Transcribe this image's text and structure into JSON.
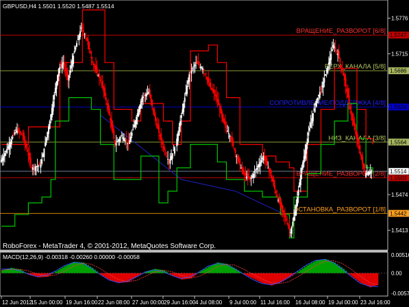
{
  "header": {
    "symbol_info": "GBPUSD,H4  1.5501  1.5520  1.5487  1.5514",
    "macd_info": "MACD(12,26,9)  -0.00318  -0.00260  0.00000  -0.00058"
  },
  "watermark": "RoboForex - MetaTrader 4, © 2001-2012, MetaQuotes Software Corp.",
  "price_axis": {
    "ticks": [
      "1.5776",
      "1.5715",
      "1.5625",
      "1.5564",
      "1.5474",
      "1.5413"
    ],
    "ylim": [
      1.5385,
      1.58
    ]
  },
  "macd_axis": {
    "ticks": [
      "0.00516",
      "0.00",
      "-0.00571"
    ]
  },
  "time_axis": {
    "ticks": [
      "12 Jun 2012",
      "15 Jun 00:00",
      "19 Jun 16:00",
      "22 Jun 08:00",
      "27 Jun 00:00",
      "29 Jun 16:00",
      "4 Jul 08:00",
      "9 Jul 00:00",
      "11 Jul 16:00",
      "16 Jul 08:00",
      "19 Jul 00:00",
      "23 Jul 16:00"
    ]
  },
  "levels": [
    {
      "label": "ВРАЩЕНИЕ_РАЗВОРОТ [6/8]",
      "price_tag": "1.5747",
      "value": 1.5747,
      "color": "#c00000",
      "text_color": "#ff3030",
      "tag_bg": "#c00000"
    },
    {
      "label": "ВЕРХ_КАНАЛА [5/8]",
      "price_tag": "1.5686",
      "value": 1.5686,
      "color": "#8a9a3a",
      "text_color": "#b8c860",
      "tag_bg": "#a8b860"
    },
    {
      "label": "СОПРОТИВЛЕНИЕ/ПОДДЕРЖКА [4/8]",
      "price_tag": "1.5624",
      "value": 1.5624,
      "color": "#0000c8",
      "text_color": "#2020ff",
      "tag_bg": "#0000c8"
    },
    {
      "label": "НИЗ_КАНАЛА [3/8]",
      "price_tag": "1.5564",
      "value": 1.5564,
      "color": "#8a9a3a",
      "text_color": "#b8c860",
      "tag_bg": "#a8b860"
    },
    {
      "label": "ВРАЩЕНИЕ_РАЗВОРОТ [2/8]",
      "price_tag": "1.5503",
      "value": 1.5503,
      "color": "#c00000",
      "text_color": "#ff3030",
      "tag_bg": "#c00000"
    },
    {
      "label": "ОСТАНОВКА_РАЗВОРОТ [1/8]",
      "price_tag": "1.5442",
      "value": 1.5442,
      "color": "#d08000",
      "text_color": "#ffa020",
      "tag_bg": "#ffa020"
    }
  ],
  "current_price": {
    "tag": "1.5514",
    "value": 1.5514
  },
  "colors": {
    "bull_candle": "#ffffff",
    "bear_candle": "#ff0000",
    "upper_channel": "#ff0000",
    "lower_channel": "#00c800",
    "diagonal_line": "#2020c0",
    "macd_pos": "#00a000",
    "macd_neg": "#e00000",
    "macd_line1": "#3050ff",
    "macd_line2": "#ff4040"
  },
  "chart_data": {
    "type": "candlestick",
    "symbol": "GBPUSD",
    "timeframe": "H4",
    "close_path": [
      [
        0,
        1.553
      ],
      [
        4,
        1.556
      ],
      [
        7,
        1.5585
      ],
      [
        10,
        1.5575
      ],
      [
        14,
        1.552
      ],
      [
        18,
        1.5525
      ],
      [
        22,
        1.56
      ],
      [
        26,
        1.569
      ],
      [
        28,
        1.57
      ],
      [
        30,
        1.567
      ],
      [
        33,
        1.572
      ],
      [
        36,
        1.576
      ],
      [
        38,
        1.5745
      ],
      [
        41,
        1.57
      ],
      [
        45,
        1.5665
      ],
      [
        48,
        1.562
      ],
      [
        51,
        1.556
      ],
      [
        54,
        1.5575
      ],
      [
        57,
        1.556
      ],
      [
        60,
        1.56
      ],
      [
        63,
        1.564
      ],
      [
        66,
        1.565
      ],
      [
        69,
        1.56
      ],
      [
        72,
        1.556
      ],
      [
        75,
        1.553
      ],
      [
        78,
        1.556
      ],
      [
        81,
        1.562
      ],
      [
        84,
        1.568
      ],
      [
        87,
        1.57
      ],
      [
        90,
        1.569
      ],
      [
        93,
        1.566
      ],
      [
        96,
        1.564
      ],
      [
        99,
        1.56
      ],
      [
        102,
        1.5575
      ],
      [
        105,
        1.554
      ],
      [
        108,
        1.551
      ],
      [
        111,
        1.55
      ],
      [
        114,
        1.552
      ],
      [
        117,
        1.554
      ],
      [
        120,
        1.551
      ],
      [
        123,
        1.547
      ],
      [
        126,
        1.544
      ],
      [
        129,
        1.541
      ],
      [
        131,
        1.5445
      ],
      [
        134,
        1.552
      ],
      [
        137,
        1.558
      ],
      [
        140,
        1.563
      ],
      [
        143,
        1.566
      ],
      [
        146,
        1.57
      ],
      [
        148,
        1.573
      ],
      [
        150,
        1.5715
      ],
      [
        153,
        1.567
      ],
      [
        156,
        1.561
      ],
      [
        159,
        1.556
      ],
      [
        162,
        1.551
      ],
      [
        165,
        1.5515
      ]
    ],
    "upper_channel": [
      [
        0,
        1.556
      ],
      [
        10,
        1.556
      ],
      [
        12,
        1.559
      ],
      [
        24,
        1.559
      ],
      [
        26,
        1.57
      ],
      [
        34,
        1.57
      ],
      [
        36,
        1.579
      ],
      [
        44,
        1.579
      ],
      [
        46,
        1.57
      ],
      [
        50,
        1.562
      ],
      [
        58,
        1.56
      ],
      [
        62,
        1.563
      ],
      [
        72,
        1.56
      ],
      [
        76,
        1.556
      ],
      [
        80,
        1.56
      ],
      [
        84,
        1.572
      ],
      [
        92,
        1.573
      ],
      [
        96,
        1.57
      ],
      [
        100,
        1.564
      ],
      [
        106,
        1.556
      ],
      [
        116,
        1.554
      ],
      [
        122,
        1.553
      ],
      [
        128,
        1.552
      ],
      [
        130,
        1.548
      ],
      [
        136,
        1.556
      ],
      [
        142,
        1.562
      ],
      [
        148,
        1.569
      ],
      [
        154,
        1.569
      ],
      [
        158,
        1.562
      ],
      [
        162,
        1.557
      ],
      [
        165,
        1.556
      ]
    ],
    "lower_channel": [
      [
        0,
        1.542
      ],
      [
        6,
        1.544
      ],
      [
        12,
        1.546
      ],
      [
        18,
        1.547
      ],
      [
        22,
        1.55
      ],
      [
        24,
        1.56
      ],
      [
        30,
        1.564
      ],
      [
        36,
        1.564
      ],
      [
        40,
        1.562
      ],
      [
        44,
        1.556
      ],
      [
        50,
        1.55
      ],
      [
        58,
        1.55
      ],
      [
        62,
        1.554
      ],
      [
        68,
        1.554
      ],
      [
        70,
        1.546
      ],
      [
        74,
        1.548
      ],
      [
        78,
        1.552
      ],
      [
        84,
        1.556
      ],
      [
        92,
        1.556
      ],
      [
        96,
        1.553
      ],
      [
        100,
        1.55
      ],
      [
        108,
        1.548
      ],
      [
        116,
        1.547
      ],
      [
        124,
        1.544
      ],
      [
        128,
        1.54
      ],
      [
        130,
        1.547
      ],
      [
        136,
        1.551
      ],
      [
        142,
        1.556
      ],
      [
        148,
        1.56
      ],
      [
        154,
        1.563
      ],
      [
        158,
        1.557
      ],
      [
        162,
        1.552
      ],
      [
        165,
        1.551
      ]
    ],
    "diagonal_line": [
      [
        44,
        1.561
      ],
      [
        80,
        1.55
      ],
      [
        104,
        1.548
      ],
      [
        126,
        1.544
      ]
    ],
    "macd_hist": [
      0.0008,
      0.0015,
      0.001,
      -0.0005,
      -0.0012,
      -0.001,
      0.0005,
      0.002,
      0.0032,
      0.003,
      0.0015,
      -0.0005,
      -0.002,
      -0.0028,
      -0.0025,
      -0.001,
      0.0005,
      0.0012,
      0.0008,
      -0.0008,
      -0.0018,
      -0.0015,
      0.0004,
      0.0018,
      0.003,
      0.0026,
      0.0012,
      -0.0004,
      -0.0016,
      -0.0028,
      -0.0035,
      -0.0026,
      -0.0012,
      0.0005,
      0.0022,
      0.0036,
      0.004,
      0.003,
      0.0012,
      -0.001,
      -0.0028,
      -0.004,
      -0.0032
    ]
  }
}
